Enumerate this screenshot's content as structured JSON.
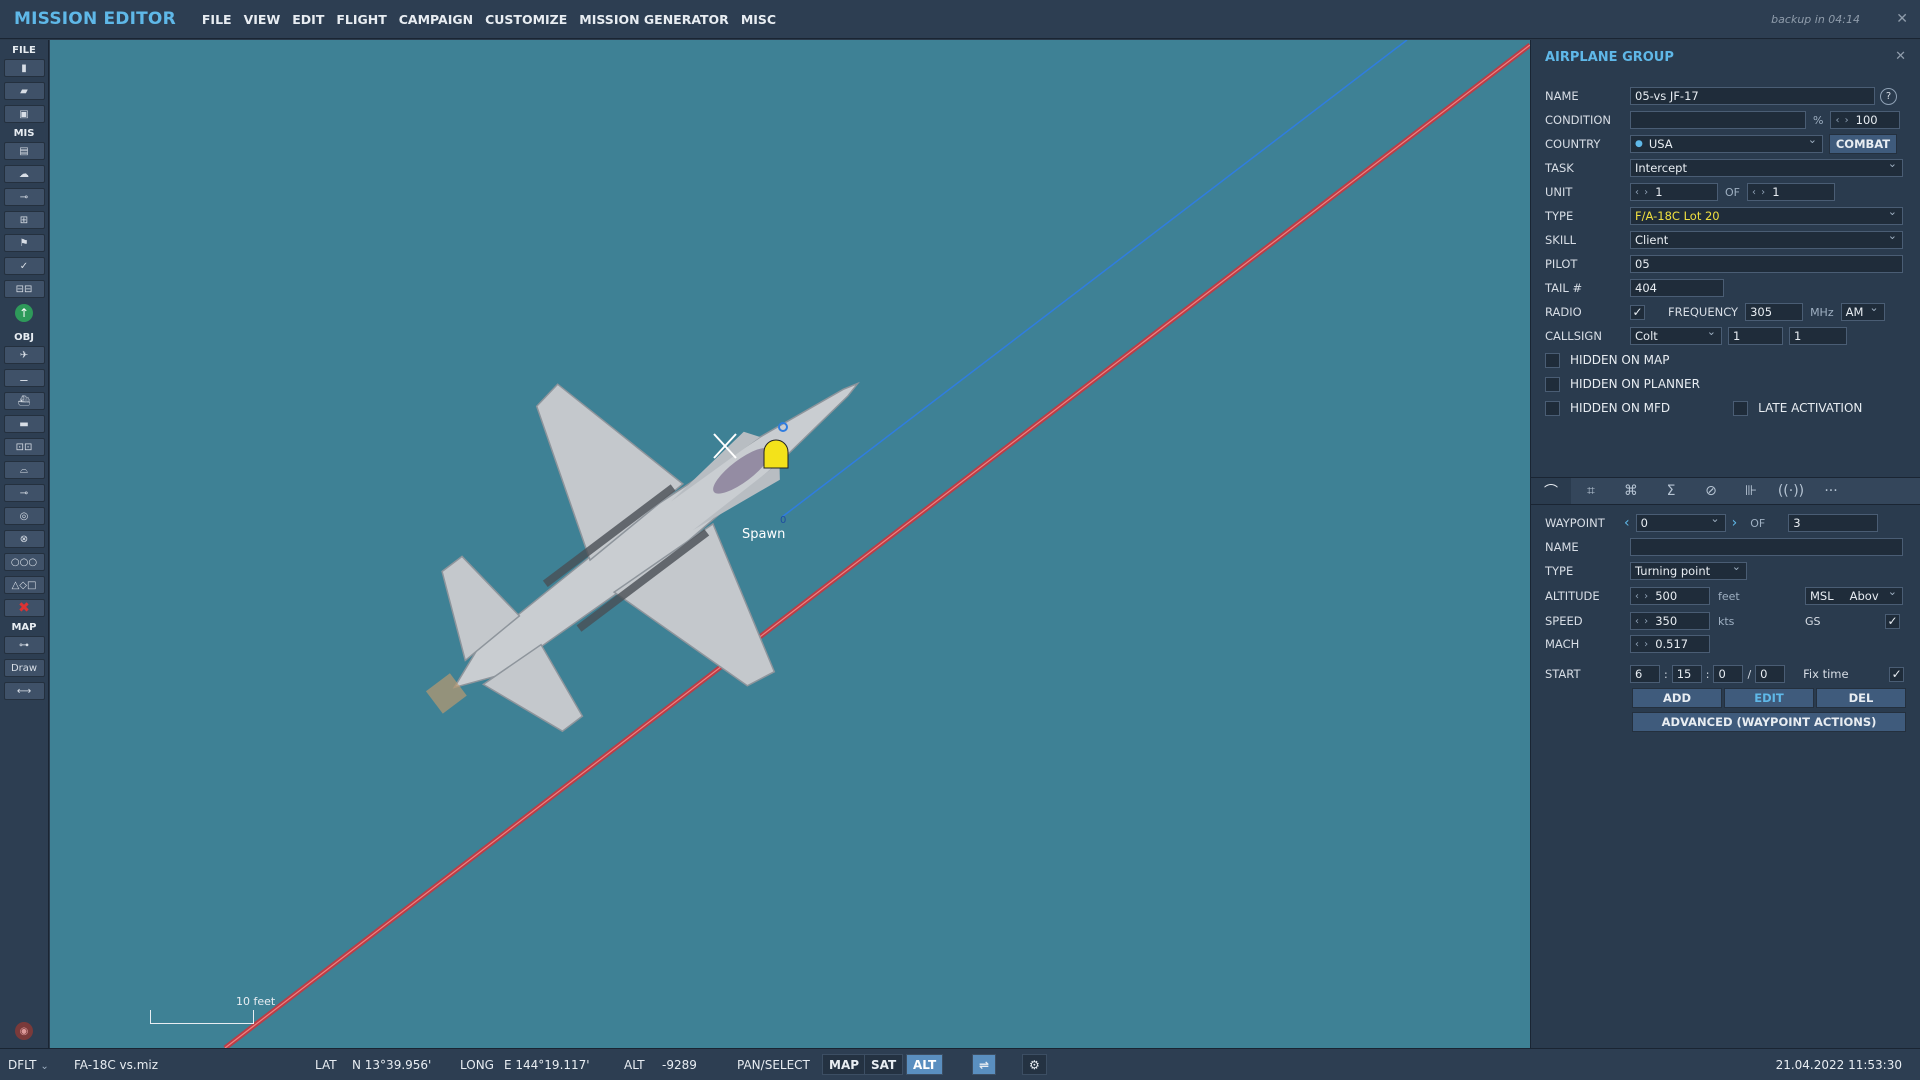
{
  "app": {
    "title": "MISSION EDITOR",
    "backup": "backup in 04:14"
  },
  "menu": [
    "FILE",
    "VIEW",
    "EDIT",
    "FLIGHT",
    "CAMPAIGN",
    "CUSTOMIZE",
    "MISSION GENERATOR",
    "MISC"
  ],
  "leftbar": {
    "file": "FILE",
    "mis": "MIS",
    "obj": "OBJ",
    "map": "MAP",
    "draw": "Draw"
  },
  "map": {
    "scale_label": "10 feet",
    "spawn_label": "Spawn",
    "waypoint_index": "0"
  },
  "panel": {
    "title": "AIRPLANE GROUP",
    "name_label": "NAME",
    "name": "05-vs JF-17",
    "condition_label": "CONDITION",
    "condition_unit": "%",
    "condition": "100",
    "country_label": "COUNTRY",
    "country": "USA",
    "combat": "COMBAT",
    "task_label": "TASK",
    "task": "Intercept",
    "unit_label": "UNIT",
    "unit": "1",
    "of_label": "OF",
    "unit_of": "1",
    "type_label": "TYPE",
    "type": "F/A-18C Lot 20",
    "skill_label": "SKILL",
    "skill": "Client",
    "pilot_label": "PILOT",
    "pilot": "05",
    "tail_label": "TAIL #",
    "tail": "404",
    "radio_label": "RADIO",
    "frequency_label": "FREQUENCY",
    "frequency": "305",
    "freq_unit": "MHz",
    "modulation": "AM",
    "callsign_label": "CALLSIGN",
    "callsign": "Colt",
    "callsign_1": "1",
    "callsign_2": "1",
    "hidden_map": "HIDDEN ON MAP",
    "hidden_planner": "HIDDEN ON PLANNER",
    "hidden_mfd": "HIDDEN ON MFD",
    "late_activation": "LATE ACTIVATION"
  },
  "waypoint": {
    "wp_label": "WAYPOINT",
    "wp": "0",
    "of_label": "OF",
    "wp_of": "3",
    "name_label": "NAME",
    "name": "",
    "type_label": "TYPE",
    "type": "Turning point",
    "alt_label": "ALTITUDE",
    "alt": "500",
    "alt_unit": "feet",
    "alt_ref": "MSL",
    "alt_ref2": "Abov",
    "speed_label": "SPEED",
    "speed": "350",
    "speed_unit": "kts",
    "gs": "GS",
    "mach_label": "MACH",
    "mach": "0.517",
    "start_label": "START",
    "start_d": "6",
    "start_h": "15",
    "start_m": "0",
    "start_s": "0",
    "fixtime": "Fix time",
    "add": "ADD",
    "edit": "EDIT",
    "del": "DEL",
    "advanced": "ADVANCED (WAYPOINT ACTIONS)"
  },
  "status": {
    "profile": "DFLT",
    "file": "FA-18C vs.miz",
    "lat_label": "LAT",
    "lat": "N 13°39.956'",
    "long_label": "LONG",
    "long": "E 144°19.117'",
    "alt_label": "ALT",
    "alt": "-9289",
    "pan": "PAN/SELECT",
    "map": "MAP",
    "sat": "SAT",
    "altbtn": "ALT",
    "datetime": "21.04.2022 11:53:30"
  },
  "colors": {
    "map_bg": "#3e8195",
    "accent": "#5fb8e8",
    "route_red": "#d0323a",
    "route_blue": "#2f7de0",
    "type_yellow": "#f0e040"
  }
}
